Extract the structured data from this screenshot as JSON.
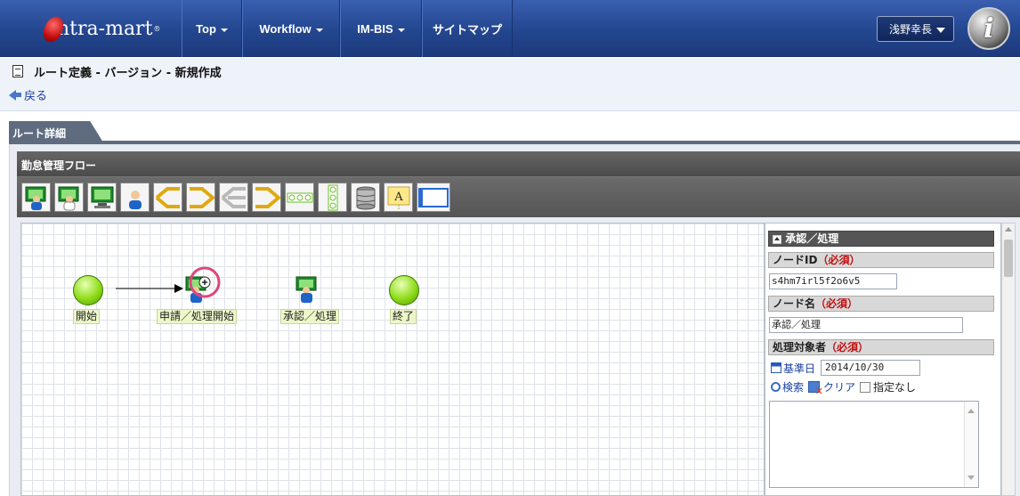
{
  "header": {
    "logo_text": "ntra-mart",
    "logo_mark": "®",
    "menu": [
      {
        "label": "Top"
      },
      {
        "label": "Workflow"
      },
      {
        "label": "IM-BIS"
      },
      {
        "label": "サイトマップ"
      }
    ],
    "user_name": "浅野幸長",
    "brand_glyph": "i"
  },
  "page": {
    "title": "ルート定義 - バージョン - 新規作成",
    "back_label": "戻る"
  },
  "tab": {
    "label": "ルート詳細"
  },
  "flow": {
    "title": "勤怠管理フロー",
    "toolbar_icons": [
      "apply-node-icon",
      "approve-node-icon",
      "process-node-icon",
      "person-node-icon",
      "branch-start-icon",
      "branch-end-icon",
      "parallel-start-icon",
      "parallel-end-icon",
      "horizontal-node-icon",
      "vertical-node-icon",
      "database-node-icon",
      "text-annotation-icon",
      "frame-icon"
    ],
    "nodes": [
      {
        "label": "開始"
      },
      {
        "label": "申請／処理開始"
      },
      {
        "label": "承認／処理"
      },
      {
        "label": "終了"
      }
    ]
  },
  "props": {
    "header": "承認／処理",
    "node_id_label": "ノードID",
    "node_id_req": "（必須）",
    "node_id_value": "s4hm7irl5f2o6v5",
    "node_name_label": "ノード名",
    "node_name_req": "（必須）",
    "node_name_value": "承認／処理",
    "target_label": "処理対象者",
    "target_req": "（必須）",
    "base_date_label": "基準日",
    "base_date_value": "2014/10/30",
    "search_label": "検索",
    "clear_label": "クリア",
    "none_label": "指定なし"
  },
  "colors": {
    "header": "#23468f",
    "highlight": "#e0457a",
    "node": "#8fdc1a",
    "required": "#c01010"
  }
}
